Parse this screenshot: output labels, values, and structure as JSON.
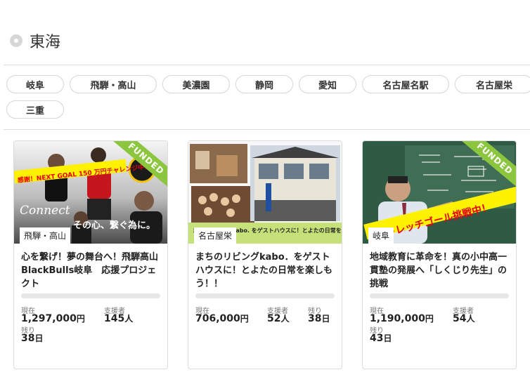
{
  "region": {
    "title": "東海"
  },
  "areas": [
    "岐阜",
    "飛騨・高山",
    "美濃園",
    "静岡",
    "愛知",
    "名古屋名駅",
    "名古屋栄",
    "三重"
  ],
  "projects": [
    {
      "location": "飛騨・高山",
      "title": "心を繋げ！夢の舞台へ！飛騨高山BlackBulls岐阜　応援プロジェクト",
      "funded": true,
      "funded_label": "FUNDED",
      "banner": "感謝！NEXT GOAL 150 万円チャレンジ中！",
      "slogan": "Connect",
      "slogan2": "その心、繋ぐ為に。",
      "progress": 0,
      "current_label": "現在",
      "current_value": "1,297,000",
      "current_unit": "円",
      "supporters_label": "支援者",
      "supporters_value": "145",
      "supporters_unit": "人",
      "remaining_label": "残り",
      "remaining_value": "38",
      "remaining_unit": "日"
    },
    {
      "location": "名古屋栄",
      "title": "まちのリビングkabo．をゲストハウスに！とよたの日常を楽しもう！！",
      "funded": false,
      "banner": "まちのリビングkabo. をゲストハウスに！とよたの日常を楽しもう！",
      "progress": 0,
      "current_label": "現在",
      "current_value": "706,000",
      "current_unit": "円",
      "supporters_label": "支援者",
      "supporters_value": "52",
      "supporters_unit": "人",
      "remaining_label": "残り",
      "remaining_value": "38",
      "remaining_unit": "日"
    },
    {
      "location": "岐阜",
      "title": "地域教育に革命を！真の小中高一貫塾の発展へ「しくじり先生」の挑戦",
      "funded": true,
      "funded_label": "FUNDED",
      "banner": "ストレッチゴール挑戦中！",
      "progress": 0,
      "current_label": "現在",
      "current_value": "1,190,000",
      "current_unit": "円",
      "supporters_label": "支援者",
      "supporters_value": "54",
      "supporters_unit": "人",
      "remaining_label": "残り",
      "remaining_value": "43",
      "remaining_unit": "日"
    }
  ],
  "colors": {
    "accent": "#8cc63f",
    "chip_border": "#d6d6d6",
    "banner_yellow": "#fff200",
    "banner_red": "#e60012"
  }
}
